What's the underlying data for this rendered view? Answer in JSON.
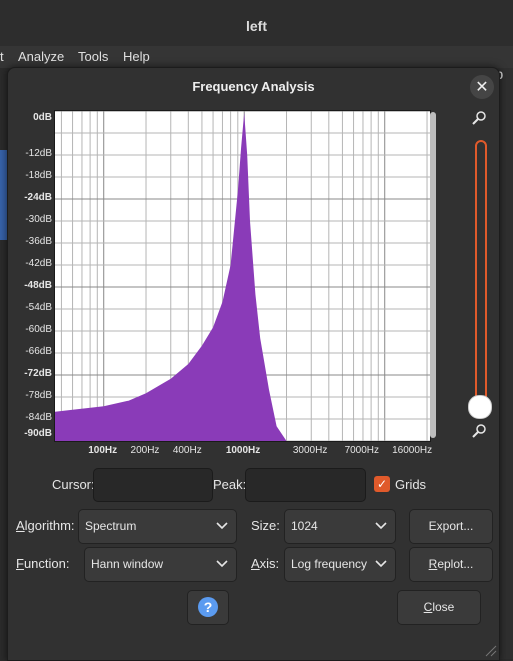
{
  "app": {
    "window_title": "left",
    "menu": [
      "Analyze",
      "Tools",
      "Help"
    ],
    "right_edge_text": "0"
  },
  "dialog": {
    "title": "Frequency Analysis",
    "close_icon": "close-x-icon"
  },
  "chart_data": {
    "type": "area",
    "y_axis": {
      "labels": [
        "0dB",
        "-12dB",
        "-18dB",
        "-24dB",
        "-30dB",
        "-36dB",
        "-42dB",
        "-48dB",
        "-54dB",
        "-60dB",
        "-66dB",
        "-72dB",
        "-78dB",
        "-84dB",
        "-90dB"
      ],
      "bold_labels": [
        "0dB",
        "-24dB",
        "-48dB",
        "-72dB",
        "-90dB"
      ],
      "ylim": [
        -90,
        0
      ]
    },
    "x_axis": {
      "labels": [
        "100Hz",
        "200Hz",
        "400Hz",
        "1000Hz",
        "3000Hz",
        "7000Hz",
        "16000Hz"
      ],
      "bold_labels": [
        "100Hz",
        "1000Hz"
      ],
      "scale": "log",
      "xlim": [
        45,
        21000
      ]
    },
    "series": [
      {
        "color": "#8a3bb8",
        "x": [
          45,
          60,
          100,
          150,
          200,
          300,
          400,
          500,
          600,
          700,
          800,
          900,
          950,
          1000,
          1050,
          1100,
          1200,
          1300,
          1500,
          1700,
          2000
        ],
        "y": [
          -82,
          -81.5,
          -80.5,
          -79,
          -77,
          -73,
          -69,
          -64,
          -59,
          -52,
          -42,
          -22,
          -10,
          -0.5,
          -12,
          -30,
          -50,
          -62,
          -76,
          -86,
          -90
        ]
      }
    ],
    "grid": true
  },
  "controls": {
    "cursor_label": "Cursor:",
    "cursor_value": "",
    "peak_label": "Peak:",
    "peak_value": "",
    "grids_label": "Grids",
    "grids_checked": true,
    "algorithm_label": "Algorithm:",
    "algorithm_value": "Spectrum",
    "size_label": "Size:",
    "size_value": "1024",
    "export_label": "Export...",
    "function_label": "Function:",
    "function_value": "Hann window",
    "axis_label": "Axis:",
    "axis_value": "Log frequency",
    "replot_label": "Replot...",
    "help_symbol": "?",
    "close_label": "Close"
  },
  "colors": {
    "accent": "#e05a2b",
    "spectrum": "#8a3bb8",
    "help": "#5b9bf0"
  }
}
